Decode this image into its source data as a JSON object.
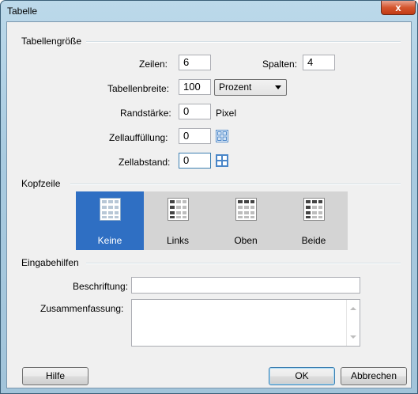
{
  "window": {
    "title": "Tabelle",
    "close_label": "x"
  },
  "table_size": {
    "group_label": "Tabellengröße",
    "rows": {
      "label": "Zeilen:",
      "value": "6"
    },
    "columns": {
      "label": "Spalten:",
      "value": "4"
    },
    "width": {
      "label": "Tabellenbreite:",
      "value": "100",
      "unit": "Prozent"
    },
    "border": {
      "label": "Randstärke:",
      "value": "0",
      "unit": "Pixel"
    },
    "padding": {
      "label": "Zellauffüllung:",
      "value": "0"
    },
    "spacing": {
      "label": "Zellabstand:",
      "value": "0"
    }
  },
  "header": {
    "group_label": "Kopfzeile",
    "options": [
      {
        "label": "Keine",
        "selected": true
      },
      {
        "label": "Links",
        "selected": false
      },
      {
        "label": "Oben",
        "selected": false
      },
      {
        "label": "Beide",
        "selected": false
      }
    ]
  },
  "accessibility": {
    "group_label": "Eingabehilfen",
    "caption": {
      "label": "Beschriftung:",
      "value": ""
    },
    "summary": {
      "label": "Zusammenfassung:",
      "value": ""
    }
  },
  "buttons": {
    "help": "Hilfe",
    "ok": "OK",
    "cancel": "Abbrechen"
  },
  "colors": {
    "selected_option": "#2f6fc3",
    "panel_bg": "#f0f0f0",
    "icon_blue": "#4a86c8"
  }
}
